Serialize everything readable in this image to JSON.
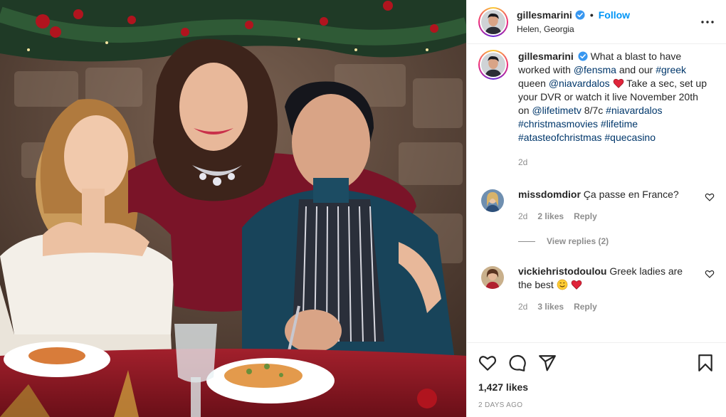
{
  "header": {
    "username": "gillesmarini",
    "follow_label": "Follow",
    "location": "Helen, Georgia",
    "separator": "•"
  },
  "caption": {
    "username": "gillesmarini",
    "text1": "What a blast to have worked with ",
    "mention1": "@fensma",
    "text2": " and our ",
    "tag1": "#greek",
    "text3": " queen ",
    "mention2": "@niavardalos",
    "text4": " Take a sec, set up your DVR or watch it live November 20th on ",
    "mention3": "@lifetimetv",
    "text5": " 8/7c ",
    "tags": [
      "#niavardalos",
      "#christmasmovies",
      "#lifetime",
      "#atasteofchristmas",
      "#quecasino"
    ],
    "time": "2d"
  },
  "comments": [
    {
      "username": "missdomdior",
      "text": "Ça passe en France?",
      "time": "2d",
      "likes": "2 likes",
      "reply_label": "Reply",
      "view_replies": "View replies (2)"
    },
    {
      "username": "vickiehristodoulou",
      "text": "Greek ladies are the best",
      "time": "2d",
      "likes": "3 likes",
      "reply_label": "Reply"
    }
  ],
  "footer": {
    "likes": "1,427 likes",
    "date": "2 DAYS AGO"
  },
  "colors": {
    "accent": "#0095f6",
    "link": "#00376b",
    "muted": "#8e8e8e",
    "heart": "#ed4956",
    "verified": "#3897f0"
  },
  "icons": {
    "more": "more-horizontal-icon",
    "like": "heart-icon",
    "comment": "comment-icon",
    "share": "paper-plane-icon",
    "save": "bookmark-icon"
  }
}
